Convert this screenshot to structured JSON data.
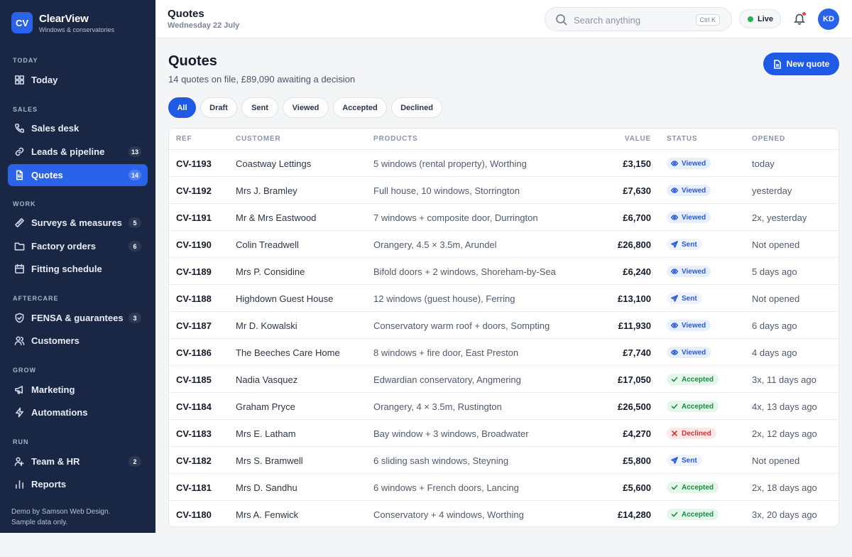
{
  "brand": {
    "logo": "CV",
    "name": "ClearView",
    "tagline": "Windows & conservatories"
  },
  "sidebar": {
    "sections": [
      "TODAY",
      "SALES",
      "WORK",
      "AFTERCARE",
      "GROW",
      "RUN"
    ],
    "items": [
      {
        "label": "Today",
        "icon": "grid-icon"
      },
      {
        "label": "Sales desk",
        "icon": "phone-icon"
      },
      {
        "label": "Leads & pipeline",
        "icon": "link-icon",
        "badge": "13"
      },
      {
        "label": "Quotes",
        "icon": "document-icon",
        "badge": "14",
        "active": true
      },
      {
        "label": "Surveys & measures",
        "icon": "ruler-icon",
        "badge": "5"
      },
      {
        "label": "Factory orders",
        "icon": "folder-icon",
        "badge": "6"
      },
      {
        "label": "Fitting schedule",
        "icon": "calendar-icon"
      },
      {
        "label": "FENSA & guarantees",
        "icon": "shield-icon",
        "badge": "3"
      },
      {
        "label": "Customers",
        "icon": "users-icon"
      },
      {
        "label": "Marketing",
        "icon": "megaphone-icon"
      },
      {
        "label": "Automations",
        "icon": "lightning-icon"
      },
      {
        "label": "Team & HR",
        "icon": "team-icon",
        "badge": "2"
      },
      {
        "label": "Reports",
        "icon": "bar-chart-icon"
      }
    ],
    "footer_line1": "Demo by Samson Web Design.",
    "footer_line2": "Sample data only."
  },
  "topbar": {
    "title": "Quotes",
    "date": "Wednesday 22 July",
    "search_placeholder": "Search anything",
    "search_shortcut": "Ctrl K",
    "live_label": "Live",
    "avatar_initials": "KD"
  },
  "main": {
    "title": "Quotes",
    "subtitle": "14 quotes on file, £89,090 awaiting a decision",
    "new_button": "New quote",
    "filters": [
      "All",
      "Draft",
      "Sent",
      "Viewed",
      "Accepted",
      "Declined"
    ],
    "active_filter": "All",
    "columns": [
      "REF",
      "CUSTOMER",
      "PRODUCTS",
      "VALUE",
      "STATUS",
      "OPENED"
    ],
    "rows": [
      {
        "ref": "CV-1193",
        "customer": "Coastway Lettings",
        "products": "5 windows (rental property), Worthing",
        "value": "£3,150",
        "status": "Viewed",
        "opened": "today"
      },
      {
        "ref": "CV-1192",
        "customer": "Mrs J. Bramley",
        "products": "Full house, 10 windows, Storrington",
        "value": "£7,630",
        "status": "Viewed",
        "opened": "yesterday"
      },
      {
        "ref": "CV-1191",
        "customer": "Mr & Mrs Eastwood",
        "products": "7 windows + composite door, Durrington",
        "value": "£6,700",
        "status": "Viewed",
        "opened": "2x, yesterday"
      },
      {
        "ref": "CV-1190",
        "customer": "Colin Treadwell",
        "products": "Orangery, 4.5 × 3.5m, Arundel",
        "value": "£26,800",
        "status": "Sent",
        "opened": "Not opened"
      },
      {
        "ref": "CV-1189",
        "customer": "Mrs P. Considine",
        "products": "Bifold doors + 2 windows, Shoreham-by-Sea",
        "value": "£6,240",
        "status": "Viewed",
        "opened": "5 days ago"
      },
      {
        "ref": "CV-1188",
        "customer": "Highdown Guest House",
        "products": "12 windows (guest house), Ferring",
        "value": "£13,100",
        "status": "Sent",
        "opened": "Not opened"
      },
      {
        "ref": "CV-1187",
        "customer": "Mr D. Kowalski",
        "products": "Conservatory warm roof + doors, Sompting",
        "value": "£11,930",
        "status": "Viewed",
        "opened": "6 days ago"
      },
      {
        "ref": "CV-1186",
        "customer": "The Beeches Care Home",
        "products": "8 windows + fire door, East Preston",
        "value": "£7,740",
        "status": "Viewed",
        "opened": "4 days ago"
      },
      {
        "ref": "CV-1185",
        "customer": "Nadia Vasquez",
        "products": "Edwardian conservatory, Angmering",
        "value": "£17,050",
        "status": "Accepted",
        "opened": "3x, 11 days ago"
      },
      {
        "ref": "CV-1184",
        "customer": "Graham Pryce",
        "products": "Orangery, 4 × 3.5m, Rustington",
        "value": "£26,500",
        "status": "Accepted",
        "opened": "4x, 13 days ago"
      },
      {
        "ref": "CV-1183",
        "customer": "Mrs E. Latham",
        "products": "Bay window + 3 windows, Broadwater",
        "value": "£4,270",
        "status": "Declined",
        "opened": "2x, 12 days ago"
      },
      {
        "ref": "CV-1182",
        "customer": "Mrs S. Bramwell",
        "products": "6 sliding sash windows, Steyning",
        "value": "£5,800",
        "status": "Sent",
        "opened": "Not opened"
      },
      {
        "ref": "CV-1181",
        "customer": "Mrs D. Sandhu",
        "products": "6 windows + French doors, Lancing",
        "value": "£5,600",
        "status": "Accepted",
        "opened": "2x, 18 days ago"
      },
      {
        "ref": "CV-1180",
        "customer": "Mrs A. Fenwick",
        "products": "Conservatory + 4 windows, Worthing",
        "value": "£14,280",
        "status": "Accepted",
        "opened": "3x, 20 days ago"
      }
    ]
  },
  "colors": {
    "sidebar_bg": "#1a2744",
    "accent": "#1f5ae6",
    "viewed": "#2a5bd7",
    "accepted": "#1c8a42",
    "declined": "#cf3434",
    "live": "#22b34f"
  }
}
